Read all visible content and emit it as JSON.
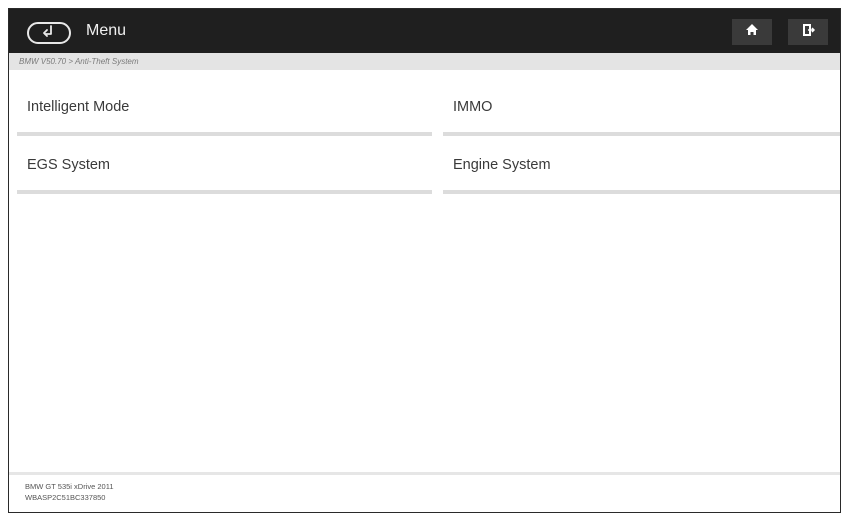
{
  "header": {
    "title": "Menu",
    "icons": {
      "back": "back-arrow-icon",
      "home": "home-icon",
      "exit": "exit-icon"
    }
  },
  "breadcrumb": "BMW V50.70 > Anti-Theft System",
  "menu": {
    "items": [
      {
        "label": "Intelligent Mode"
      },
      {
        "label": "IMMO"
      },
      {
        "label": "EGS System"
      },
      {
        "label": "Engine System"
      }
    ]
  },
  "footer": {
    "vehicle": "BMW GT 535i xDrive 2011",
    "vin": "WBASP2C51BC337850"
  },
  "colors": {
    "topbar": "#1f1f1f",
    "topbar_button": "#3a3a3a",
    "breadcrumb_bg": "#e4e4e4",
    "tile_border": "#dcdcdc"
  }
}
